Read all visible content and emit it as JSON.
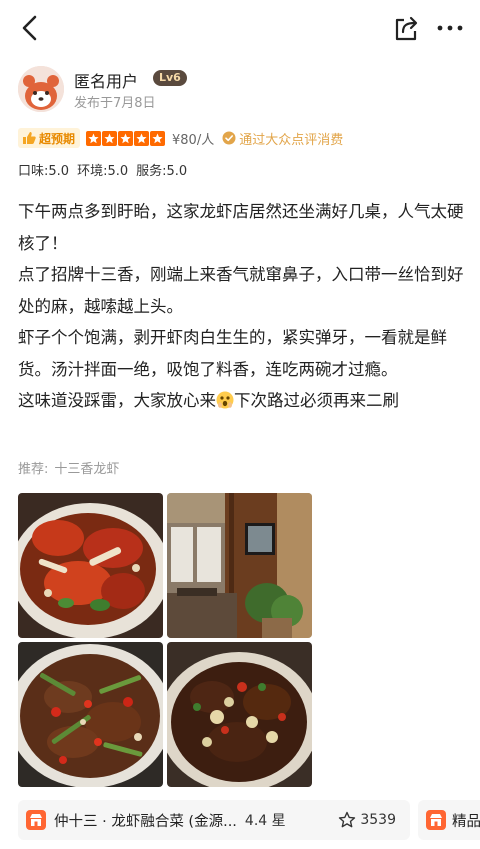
{
  "header": {
    "back_icon": "chevron-left-icon",
    "share_icon": "share-icon",
    "more_icon": "more-dots-icon"
  },
  "author": {
    "name": "匿名用户",
    "level": "Lv6",
    "post_date": "发布于7月8日"
  },
  "rating": {
    "badge": "超预期",
    "stars": 5,
    "price": "¥80/人",
    "verified": "通过大众点评消费"
  },
  "subscores": {
    "taste": "口味:5.0",
    "environment": "环境:5.0",
    "service": "服务:5.0"
  },
  "review": {
    "lines": [
      "下午两点多到盱眙，这家龙虾店居然还坐满好几桌，人气太硬核了！",
      "点了招牌十三香，刚端上来香气就窜鼻子，入口带一丝恰到好处的麻，越嗦越上头。",
      "虾子个个饱满，剥开虾肉白生生的，紧实弹牙，一看就是鲜货。汤汁拌面一绝，吸饱了料香，连吃两碗才过瘾。"
    ],
    "last_line_before_emoji": "这味道没踩雷，大家放心来",
    "last_line_after_emoji": "下次路过必须再来二刷"
  },
  "recommend": {
    "label": "推荐:",
    "dish": "十三香龙虾"
  },
  "photos": [
    {
      "name": "photo-crayfish-plate"
    },
    {
      "name": "photo-restaurant-interior"
    },
    {
      "name": "photo-beef-peppers"
    },
    {
      "name": "photo-braised-dish"
    }
  ],
  "shop_card": {
    "name": "仲十三 · 龙虾融合菜 (金源...",
    "rating": "4.4 星",
    "favorites": "3539"
  },
  "shop_card2": {
    "name": "精品"
  },
  "colors": {
    "accent_orange": "#ff6a00",
    "badge_bg": "#fff3d9",
    "verified": "#e2a54a"
  }
}
